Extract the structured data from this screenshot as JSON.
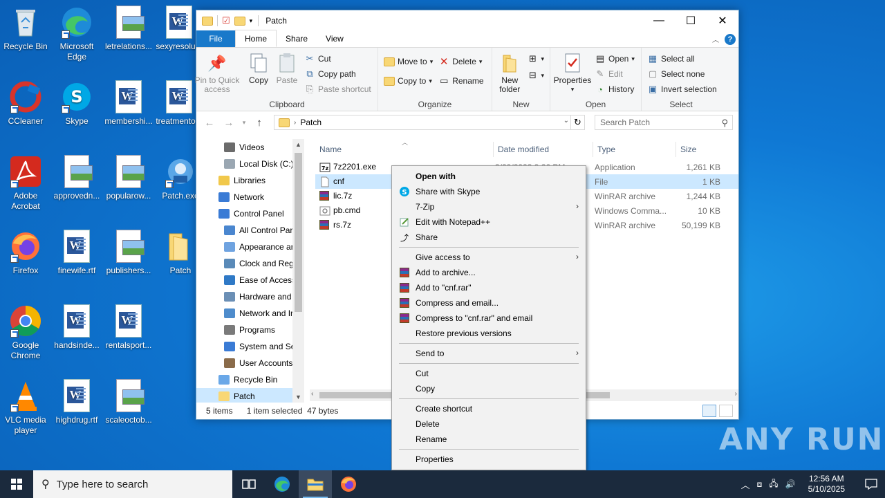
{
  "desktop": {
    "icons": [
      {
        "label": "Recycle Bin"
      },
      {
        "label": "Microsoft Edge"
      },
      {
        "label": "letrelations..."
      },
      {
        "label": "sexyresolu..."
      },
      {
        "label": "CCleaner"
      },
      {
        "label": "Skype"
      },
      {
        "label": "membershi..."
      },
      {
        "label": "treatmento..."
      },
      {
        "label": "Adobe Acrobat"
      },
      {
        "label": "approvedn..."
      },
      {
        "label": "popularow..."
      },
      {
        "label": "Patch.exe"
      },
      {
        "label": "Firefox"
      },
      {
        "label": "finewife.rtf"
      },
      {
        "label": "publishers..."
      },
      {
        "label": "Patch"
      },
      {
        "label": "Google Chrome"
      },
      {
        "label": "handsinde..."
      },
      {
        "label": "rentalsport..."
      },
      {
        "label": "VLC media player"
      },
      {
        "label": "highdrug.rtf"
      },
      {
        "label": "scaleoctob..."
      }
    ],
    "watermark": "ANY RUN"
  },
  "explorer": {
    "title": "Patch",
    "tabs": {
      "file": "File",
      "home": "Home",
      "share": "Share",
      "view": "View"
    },
    "help": "?",
    "ribbon": {
      "clipboard": {
        "label": "Clipboard",
        "pin": "Pin to Quick access",
        "copy": "Copy",
        "paste": "Paste",
        "cut": "Cut",
        "copy_path": "Copy path",
        "paste_shortcut": "Paste shortcut"
      },
      "organize": {
        "label": "Organize",
        "move_to": "Move to",
        "copy_to": "Copy to",
        "delete": "Delete",
        "rename": "Rename"
      },
      "new": {
        "label": "New",
        "new_folder": "New folder"
      },
      "open": {
        "label": "Open",
        "properties": "Properties",
        "open": "Open",
        "edit": "Edit",
        "history": "History"
      },
      "select": {
        "label": "Select",
        "select_all": "Select all",
        "select_none": "Select none",
        "invert": "Invert selection"
      }
    },
    "address": {
      "path": "Patch",
      "search_placeholder": "Search Patch"
    },
    "nav": [
      {
        "label": "Videos",
        "indent": 2
      },
      {
        "label": "Local Disk (C:)",
        "indent": 2
      },
      {
        "label": "Libraries",
        "indent": 1
      },
      {
        "label": "Network",
        "indent": 1
      },
      {
        "label": "Control Panel",
        "indent": 1
      },
      {
        "label": "All Control Par",
        "indent": 2
      },
      {
        "label": "Appearance an",
        "indent": 2
      },
      {
        "label": "Clock and Regi",
        "indent": 2
      },
      {
        "label": "Ease of Access",
        "indent": 2
      },
      {
        "label": "Hardware and",
        "indent": 2
      },
      {
        "label": "Network and Ir",
        "indent": 2
      },
      {
        "label": "Programs",
        "indent": 2
      },
      {
        "label": "System and Sec",
        "indent": 2
      },
      {
        "label": "User Accounts",
        "indent": 2
      },
      {
        "label": "Recycle Bin",
        "indent": 1
      },
      {
        "label": "Patch",
        "indent": 1
      }
    ],
    "columns": {
      "name": "Name",
      "date": "Date modified",
      "type": "Type",
      "size": "Size"
    },
    "files": [
      {
        "name": "7z2201.exe",
        "date": "3/29/2023 9:26 PM",
        "type": "Application",
        "size": "1,261 KB"
      },
      {
        "name": "cnf",
        "date": "",
        "type": "File",
        "size": "1 KB"
      },
      {
        "name": "lic.7z",
        "date": "",
        "type": "WinRAR archive",
        "size": "1,244 KB"
      },
      {
        "name": "pb.cmd",
        "date": "",
        "type": "Windows Comma...",
        "size": "10 KB"
      },
      {
        "name": "rs.7z",
        "date": "",
        "type": "WinRAR archive",
        "size": "50,199 KB"
      }
    ],
    "status": {
      "count": "5 items",
      "selection": "1 item selected  47 bytes"
    }
  },
  "context_menu": {
    "open_with": "Open with",
    "share_skype": "Share with Skype",
    "seven_zip": "7-Zip",
    "edit_notepad": "Edit with Notepad++",
    "share": "Share",
    "give_access": "Give access to",
    "add_archive": "Add to archive...",
    "add_cnf_rar": "Add to \"cnf.rar\"",
    "compress_email": "Compress and email...",
    "compress_cnf_email": "Compress to \"cnf.rar\" and email",
    "restore": "Restore previous versions",
    "send_to": "Send to",
    "cut": "Cut",
    "copy": "Copy",
    "create_shortcut": "Create shortcut",
    "delete": "Delete",
    "rename": "Rename",
    "properties": "Properties"
  },
  "taskbar": {
    "search_placeholder": "Type here to search",
    "time": "12:56 AM",
    "date": "5/10/2025"
  }
}
